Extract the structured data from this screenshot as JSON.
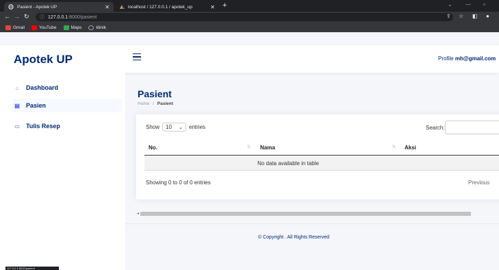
{
  "browser": {
    "tabs": [
      {
        "title": "Pasient - Apotek UP",
        "active": true,
        "icon": "globe-icon"
      },
      {
        "title": "localhost / 127.0.0.1 / apotek_up",
        "active": false,
        "icon": "phpmyadmin-icon"
      }
    ],
    "url_host": "127.0.0.1",
    "url_path": ":8000/pasient",
    "bookmarks": [
      {
        "label": "Gmail",
        "icon": "gmail-icon",
        "color": "#ea4335"
      },
      {
        "label": "YouTube",
        "icon": "youtube-icon",
        "color": "#ff0000"
      },
      {
        "label": "Maps",
        "icon": "maps-icon",
        "color": "#34a853"
      },
      {
        "label": "klinik",
        "icon": "globe-icon",
        "color": "#9aa0a6"
      }
    ],
    "status_url": "127.0.0.1:8000/pasient"
  },
  "app": {
    "brand": "Apotek UP",
    "profile_label": "Profile",
    "profile_email": "mh@gmail.com",
    "accent": "#012970"
  },
  "sidebar": {
    "items": [
      {
        "label": "Dashboard",
        "icon": "home-icon",
        "active": false
      },
      {
        "label": "Pasien",
        "icon": "clipboard-icon",
        "active": true
      },
      {
        "label": "Tulis Resep",
        "icon": "document-icon",
        "active": false
      }
    ]
  },
  "main": {
    "title": "Pasient",
    "breadcrumb": {
      "home": "Home",
      "separator": "/",
      "current": "Pasient"
    },
    "table": {
      "show_label": "Show",
      "entries_value": "10",
      "entries_label": "entries",
      "search_label": "Search:",
      "search_value": "",
      "columns": [
        "No.",
        "Nama",
        "Aksi"
      ],
      "empty_message": "No data available in table",
      "info": "Showing 0 to 0 of 0 entries",
      "prev_label": "Previous"
    }
  },
  "footer": {
    "copyright": "© Copyright . All Rights Reserved"
  }
}
